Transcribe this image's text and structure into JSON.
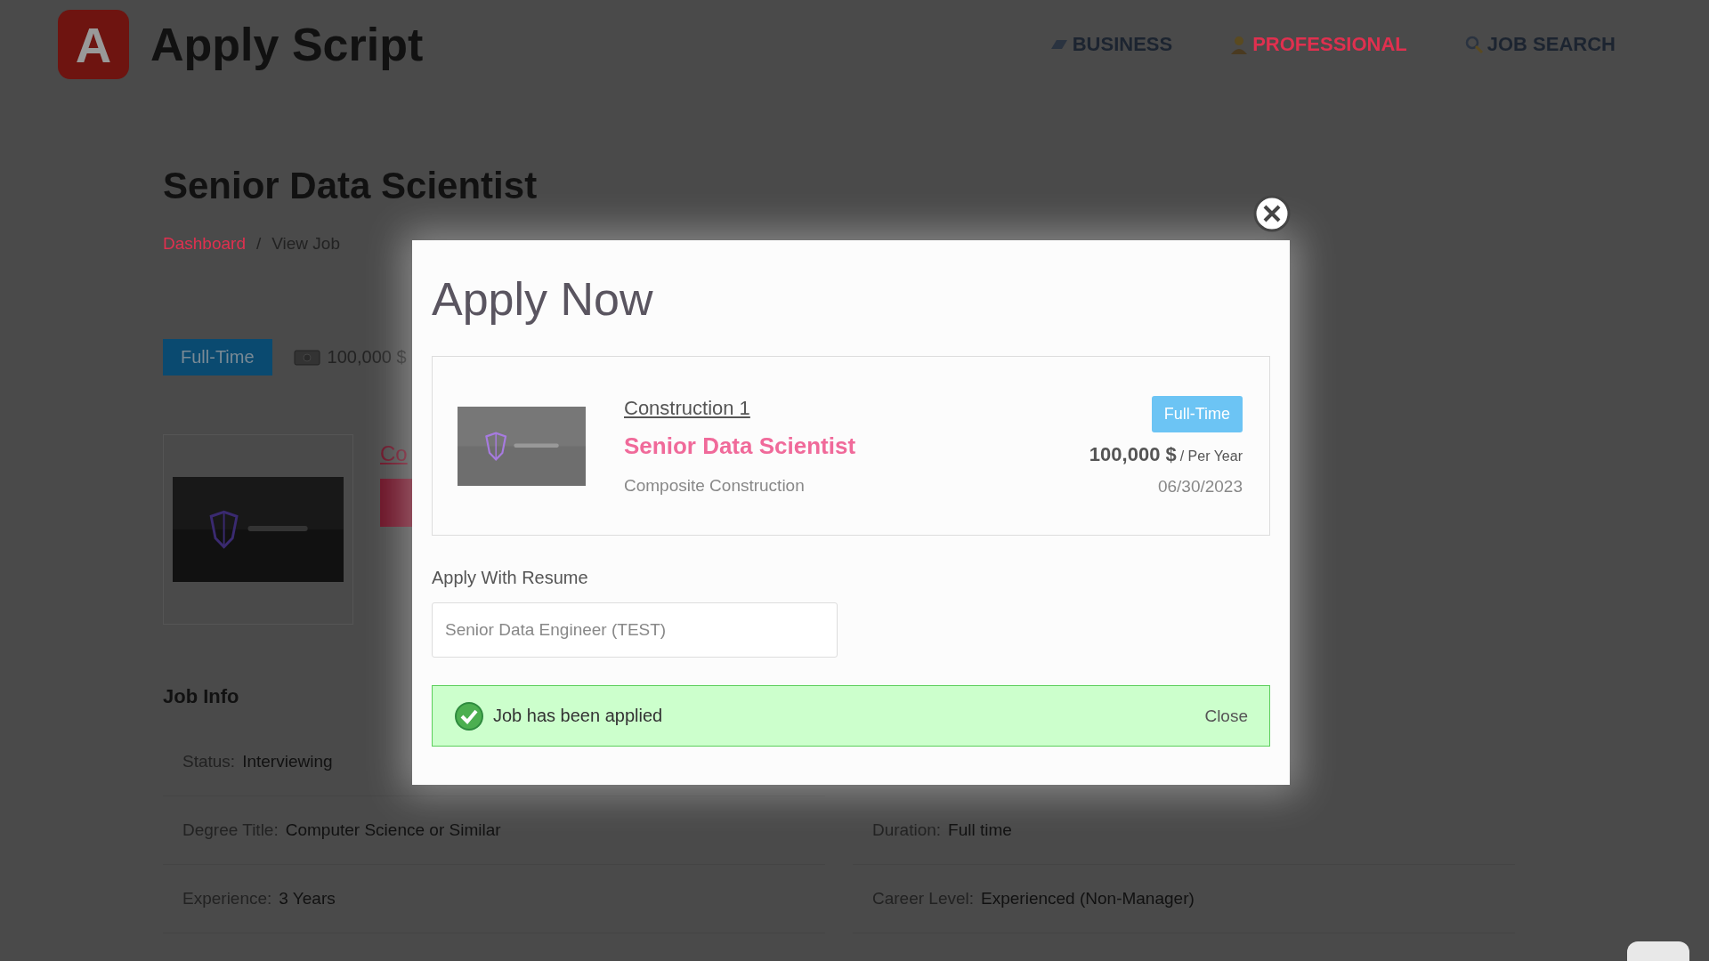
{
  "header": {
    "logo_letter": "A",
    "brand": "Apply Script",
    "nav": [
      {
        "label": "BUSINESS",
        "kind": "business",
        "selected": false
      },
      {
        "label": "PROFESSIONAL",
        "kind": "professional",
        "selected": true
      },
      {
        "label": "JOB SEARCH",
        "kind": "search",
        "selected": false
      }
    ]
  },
  "page": {
    "title": "Senior Data Scientist",
    "breadcrumb": [
      {
        "label": "Dashboard",
        "kind": "link"
      },
      {
        "label": "/",
        "kind": "separator"
      },
      {
        "label": "View Job",
        "kind": "current"
      }
    ],
    "type_badge": "Full-Time",
    "salary": "100,000 $",
    "company_link": "Co",
    "job_info": {
      "heading": "Job Info",
      "rows": [
        [
          {
            "label": "Status:",
            "value": "Interviewing"
          }
        ],
        [
          {
            "label": "Degree Title:",
            "value": "Computer Science or Similar"
          },
          {
            "label": "Duration:",
            "value": "Full time"
          }
        ],
        [
          {
            "label": "Experience:",
            "value": "3 Years"
          },
          {
            "label": "Career Level:",
            "value": "Experienced (Non-Manager)"
          }
        ]
      ]
    }
  },
  "modal": {
    "title": "Apply Now",
    "job": {
      "company": "Construction 1",
      "title": "Senior Data Scientist",
      "location": "Composite Construction",
      "type_badge": "Full-Time",
      "salary": "100,000 $",
      "period": "/ Per Year",
      "date": "06/30/2023"
    },
    "resume": {
      "label": "Apply With Resume",
      "value": "Senior Data Engineer (TEST)"
    },
    "alert": {
      "message": "Job has been applied",
      "close": "Close"
    }
  }
}
